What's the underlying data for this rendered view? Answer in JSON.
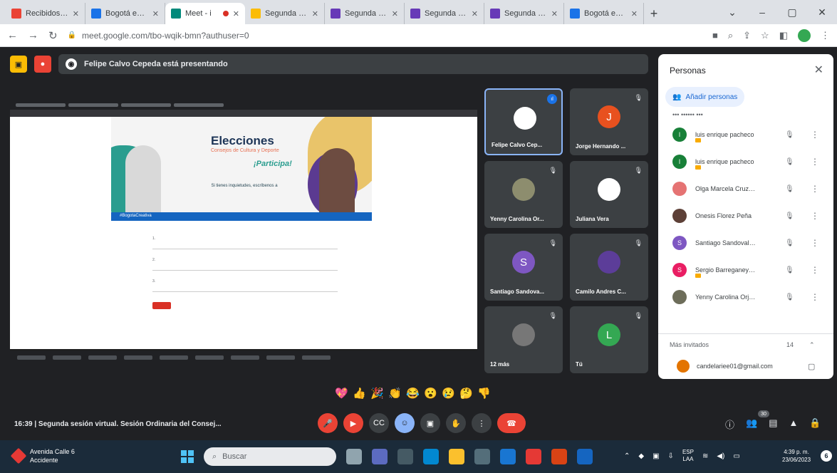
{
  "browser": {
    "tabs": [
      {
        "title": "Recibidos (4.1",
        "color": "#ea4335",
        "active": false
      },
      {
        "title": "Bogotá es TI",
        "color": "#1a73e8",
        "active": false
      },
      {
        "title": "Meet - i",
        "color": "#00897b",
        "active": true,
        "recording": true
      },
      {
        "title": "Segunda ses",
        "color": "#fbbc04",
        "active": false
      },
      {
        "title": "Segunda Se",
        "color": "#673ab7",
        "active": false
      },
      {
        "title": "Segunda Se",
        "color": "#673ab7",
        "active": false
      },
      {
        "title": "Segunda Se",
        "color": "#673ab7",
        "active": false
      },
      {
        "title": "Bogotá es TI",
        "color": "#1a73e8",
        "active": false
      }
    ],
    "url": "meet.google.com/tbo-wqik-bmn?authuser=0",
    "new_tab": "+",
    "window_controls": [
      "⌄",
      "–",
      "▢",
      "✕"
    ]
  },
  "meet": {
    "presenter_text": "Felipe Calvo Cepeda está presentando",
    "shared_screen": {
      "banner_title": "Elecciones",
      "banner_subtitle": "Consejos de Cultura y Deporte",
      "banner_participa": "¡Participa!",
      "banner_message": "Si tienes inquietudes, escríbenos a",
      "banner_band": "#BogotaCreativa"
    },
    "tiles": [
      {
        "name": "Felipe Calvo Cep...",
        "avatar_color": "#ffffff",
        "avatar_letter": "",
        "speaking": true
      },
      {
        "name": "Jorge Hernando ...",
        "avatar_color": "#e8511f",
        "avatar_letter": "J"
      },
      {
        "name": "Yenny Carolina Or...",
        "avatar_color": "#8d8d6e",
        "avatar_letter": ""
      },
      {
        "name": "Juliana Vera",
        "avatar_color": "#ffffff",
        "avatar_letter": ""
      },
      {
        "name": "Santiago Sandova...",
        "avatar_color": "#7e57c2",
        "avatar_letter": "S"
      },
      {
        "name": "Camilo Andres C...",
        "avatar_color": "#5c3d99",
        "avatar_letter": ""
      },
      {
        "name": "12 más",
        "avatar_color": "#777777",
        "avatar_letter": ""
      },
      {
        "name": "Tú",
        "avatar_color": "#34a853",
        "avatar_letter": "L"
      }
    ],
    "reactions": [
      "💖",
      "👍",
      "🎉",
      "👏",
      "😂",
      "😮",
      "😢",
      "🤔",
      "👎"
    ],
    "meeting_info": "16:39  |  Segunda sesión virtual. Sesión Ordinaria del Consej...",
    "participant_count": "30"
  },
  "people_panel": {
    "title": "Personas",
    "add_people": "Añadir personas",
    "partial_row": "•••  ••••••  •••",
    "participants": [
      {
        "name": "luis enrique pacheco",
        "color": "#188038",
        "letter": "l",
        "hand": true
      },
      {
        "name": "luis enrique pacheco",
        "color": "#188038",
        "letter": "l",
        "hand": true
      },
      {
        "name": "Olga Marcela Cruz Mon...",
        "color": "#e57373",
        "letter": "",
        "hand": false
      },
      {
        "name": "Onesis Florez Peña",
        "color": "#5d4037",
        "letter": "",
        "hand": false
      },
      {
        "name": "Santiago Sandoval Páez",
        "color": "#7e57c2",
        "letter": "S",
        "hand": false
      },
      {
        "name": "Sergio Barreganey Oroz",
        "color": "#e91e63",
        "letter": "S",
        "hand": true
      },
      {
        "name": "Yenny Carolina Orjuela ...",
        "color": "#6d6d5a",
        "letter": "",
        "hand": false
      }
    ],
    "more_invited": "Más invitados",
    "more_invited_count": "14",
    "invitee_email": "candelariee01@gmail.com"
  },
  "taskbar": {
    "weather_line1": "Avenida Calle 6",
    "weather_line2": "Accidente",
    "search_placeholder": "Buscar",
    "lang_line1": "ESP",
    "lang_line2": "LAA",
    "time": "4:39 p. m.",
    "date": "23/06/2023",
    "notification_count": "6"
  }
}
